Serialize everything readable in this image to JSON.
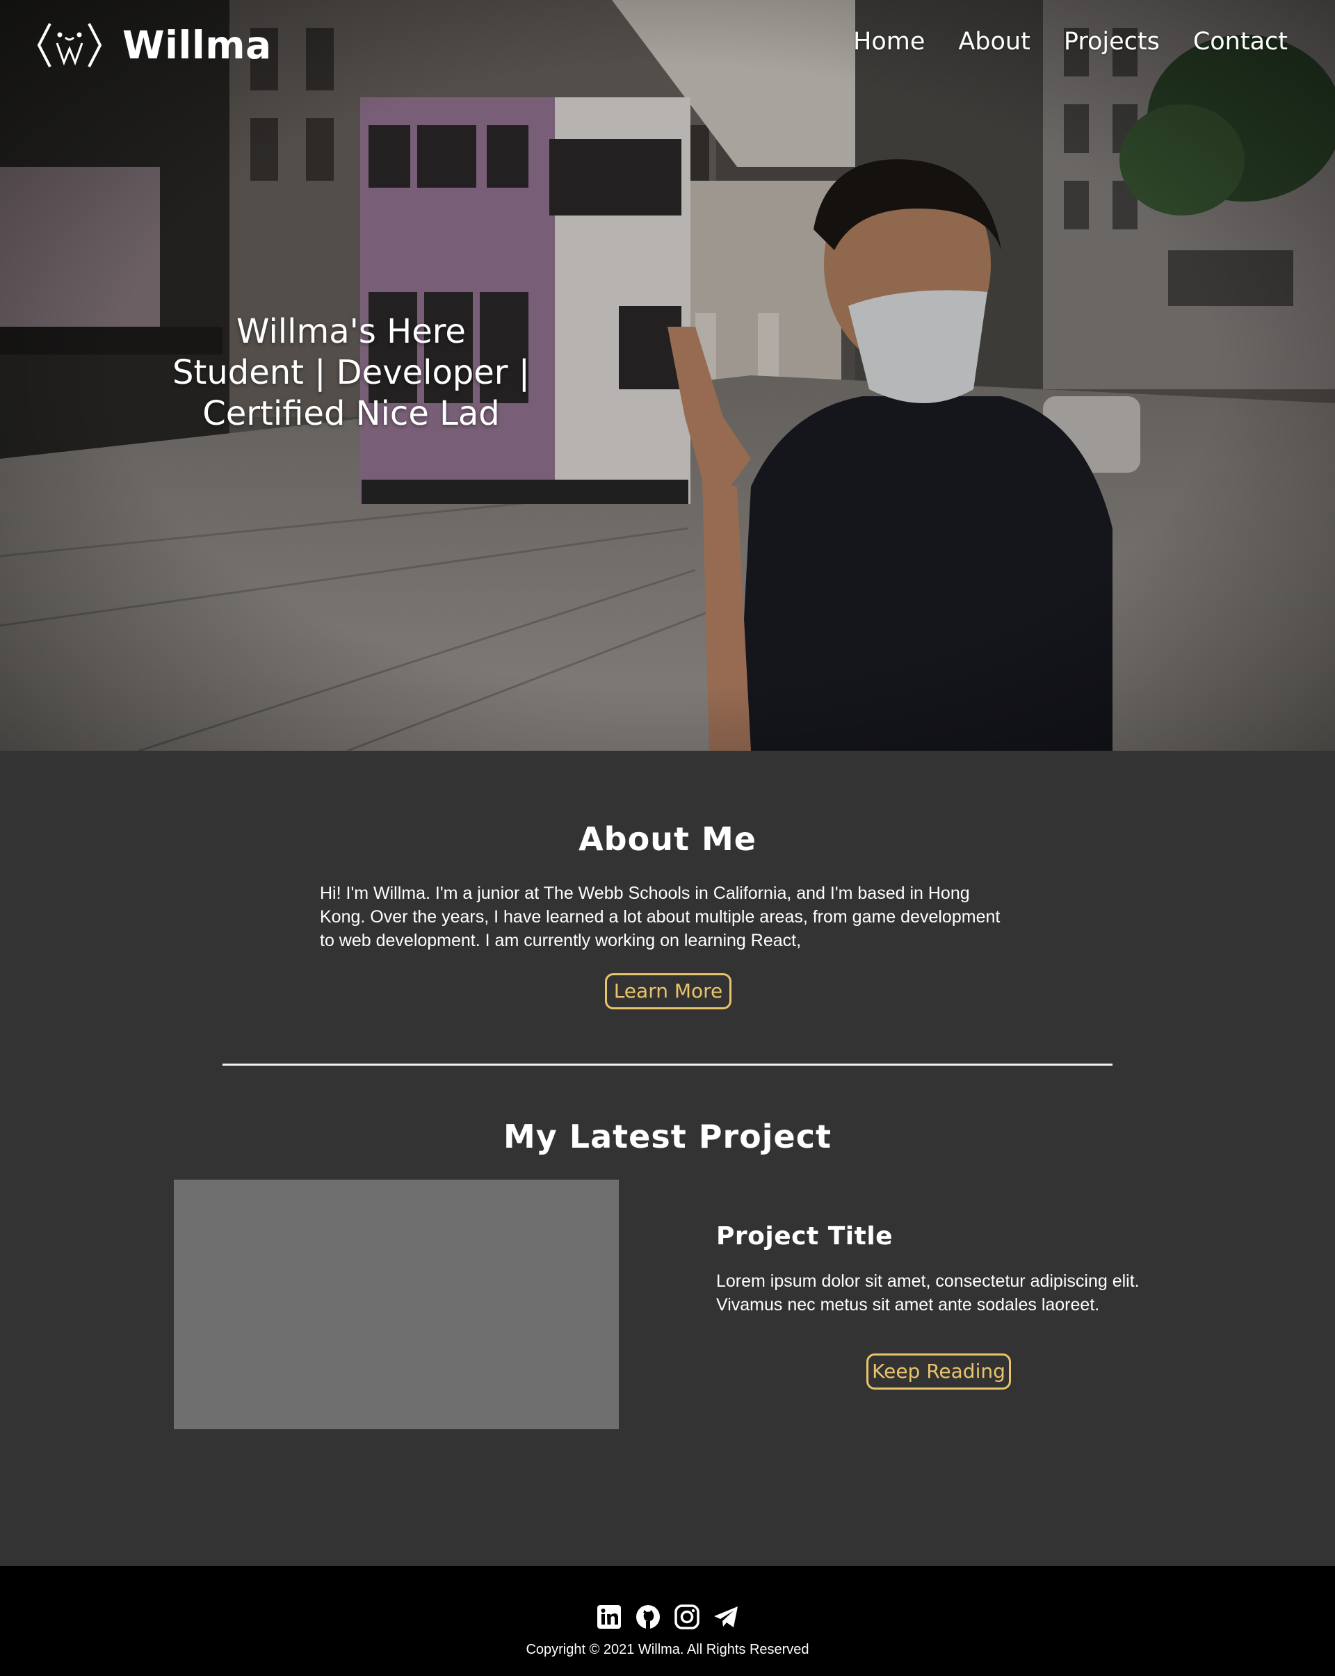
{
  "brand": {
    "name": "Willma"
  },
  "nav": {
    "items": [
      {
        "label": "Home"
      },
      {
        "label": "About"
      },
      {
        "label": "Projects"
      },
      {
        "label": "Contact"
      }
    ]
  },
  "hero": {
    "line1": "Willma's Here",
    "line2": "Student | Developer |",
    "line3": "Certified Nice Lad"
  },
  "about": {
    "heading": "About Me",
    "text": "Hi! I'm Willma. I'm a junior at The Webb Schools in California, and I'm based in Hong Kong. Over the years, I have learned a lot about multiple areas, from game development to web development. I am currently working on learning React,",
    "button": "Learn More"
  },
  "project": {
    "heading": "My Latest Project",
    "title": "Project Title",
    "description": "Lorem ipsum dolor sit amet, consectetur adipiscing elit. Vivamus nec metus sit amet ante sodales laoreet.",
    "button": "Keep Reading"
  },
  "footer": {
    "socials": [
      "linkedin-icon",
      "github-icon",
      "instagram-icon",
      "telegram-icon"
    ],
    "copyright": "Copyright © 2021 Willma. All Rights Reserved"
  },
  "colors": {
    "page_bg": "#333333",
    "accent": "#e9c46a",
    "footer_bg": "#000000",
    "placeholder": "#6f6f6f"
  }
}
